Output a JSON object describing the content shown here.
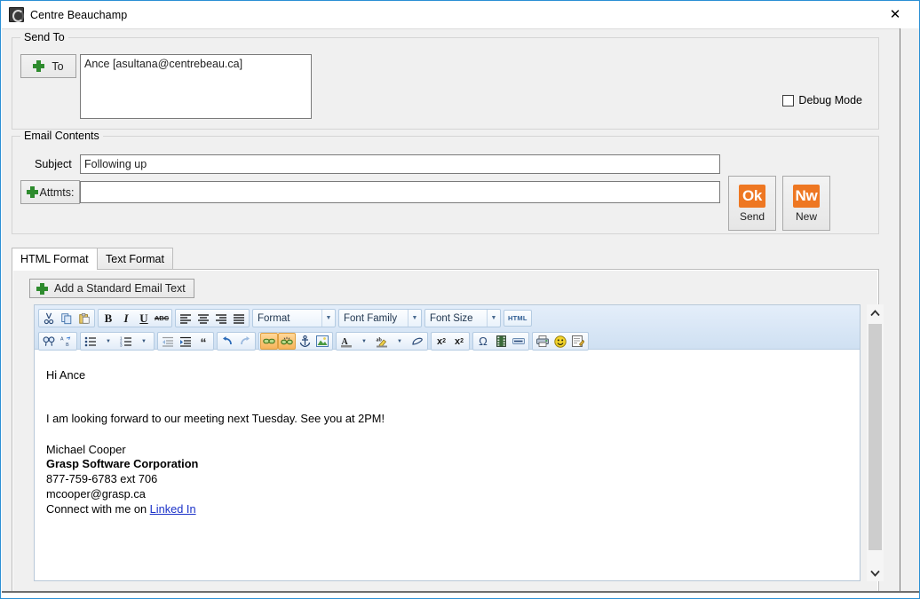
{
  "window": {
    "title": "Centre Beauchamp",
    "app_icon": "circle-c-logo-icon",
    "close_label": "✕"
  },
  "send_to": {
    "legend": "Send To",
    "to_button_label": "To",
    "to_button_icon": "plus-icon",
    "recipients_value": "Ance [asultana@centrebeau.ca]",
    "debug_mode_label": "Debug Mode",
    "debug_mode_checked": false
  },
  "email_contents": {
    "legend": "Email Contents",
    "subject_label": "Subject",
    "subject_value": "Following up",
    "attachments_button_label": "Attmts:",
    "attachments_button_icon": "plus-icon",
    "attachments_value": "",
    "actions": [
      {
        "glyph": "Ok",
        "caption": "Send",
        "name": "send-button"
      },
      {
        "glyph": "Nw",
        "caption": "New",
        "name": "new-button"
      }
    ],
    "action_glyph_color": "#ee7722"
  },
  "tabs": [
    {
      "label": "HTML Format",
      "active": true
    },
    {
      "label": "Text Format",
      "active": false
    }
  ],
  "standard_text_button": {
    "label": "Add a Standard Email Text",
    "icon": "plus-icon"
  },
  "editor": {
    "toolbar_row1": [
      {
        "group": 1,
        "name": "cut-icon",
        "glyph": "✂",
        "state": "normal"
      },
      {
        "group": 1,
        "name": "copy-icon",
        "glyph": "⧉",
        "state": "normal"
      },
      {
        "group": 1,
        "name": "paste-icon",
        "glyph": "ὌB",
        "state": "normal"
      },
      {
        "group": 2,
        "name": "bold-icon",
        "glyph": "B",
        "state": "normal"
      },
      {
        "group": 2,
        "name": "italic-icon",
        "glyph": "I",
        "state": "normal"
      },
      {
        "group": 2,
        "name": "underline-icon",
        "glyph": "U",
        "state": "normal"
      },
      {
        "group": 2,
        "name": "strikethrough-icon",
        "glyph": "ABC",
        "state": "normal"
      },
      {
        "group": 3,
        "name": "align-left-icon",
        "glyph": "≡",
        "state": "normal"
      },
      {
        "group": 3,
        "name": "align-center-icon",
        "glyph": "≡",
        "state": "normal"
      },
      {
        "group": 3,
        "name": "align-right-icon",
        "glyph": "≡",
        "state": "normal"
      },
      {
        "group": 3,
        "name": "align-justify-icon",
        "glyph": "≡",
        "state": "normal"
      }
    ],
    "selects": [
      {
        "name": "format-select",
        "label": "Format"
      },
      {
        "name": "font-family-select",
        "label": "Font Family"
      },
      {
        "name": "font-size-select",
        "label": "Font Size"
      }
    ],
    "source_button_label": "HTML",
    "toolbar_row2": [
      {
        "group": 1,
        "name": "find-icon",
        "glyph": "☍",
        "state": "normal"
      },
      {
        "group": 1,
        "name": "replace-icon",
        "glyph": "↱",
        "state": "normal"
      },
      {
        "group": 2,
        "name": "bulleted-list-icon",
        "glyph": "☰",
        "state": "normal"
      },
      {
        "group": 2,
        "name": "bulleted-list-arrow-icon",
        "glyph": "▼",
        "state": "normal"
      },
      {
        "group": 2,
        "name": "numbered-list-icon",
        "glyph": "☰",
        "state": "normal"
      },
      {
        "group": 2,
        "name": "numbered-list-arrow-icon",
        "glyph": "▼",
        "state": "normal"
      },
      {
        "group": 3,
        "name": "outdent-icon",
        "glyph": "⇤",
        "state": "disabled"
      },
      {
        "group": 3,
        "name": "indent-icon",
        "glyph": "⇥",
        "state": "normal"
      },
      {
        "group": 3,
        "name": "blockquote-icon",
        "glyph": "“",
        "state": "normal"
      },
      {
        "group": 4,
        "name": "undo-icon",
        "glyph": "↶",
        "state": "normal"
      },
      {
        "group": 4,
        "name": "redo-icon",
        "glyph": "↷",
        "state": "disabled"
      },
      {
        "group": 5,
        "name": "link-icon",
        "glyph": "⚭",
        "state": "highlighted"
      },
      {
        "group": 5,
        "name": "unlink-icon",
        "glyph": "⚭",
        "state": "highlighted"
      },
      {
        "group": 5,
        "name": "anchor-icon",
        "glyph": "⚓",
        "state": "normal"
      },
      {
        "group": 5,
        "name": "image-icon",
        "glyph": "ἳ2",
        "state": "normal"
      },
      {
        "group": 6,
        "name": "text-color-icon",
        "glyph": "A",
        "state": "normal"
      },
      {
        "group": 6,
        "name": "text-color-arrow-icon",
        "glyph": "▼",
        "state": "normal"
      },
      {
        "group": 6,
        "name": "background-color-icon",
        "glyph": "ab",
        "state": "normal"
      },
      {
        "group": 6,
        "name": "background-color-arrow-icon",
        "glyph": "▼",
        "state": "normal"
      },
      {
        "group": 6,
        "name": "remove-format-icon",
        "glyph": "◡",
        "state": "normal"
      },
      {
        "group": 7,
        "name": "subscript-icon",
        "glyph": "x",
        "state": "normal"
      },
      {
        "group": 7,
        "name": "superscript-icon",
        "glyph": "x",
        "state": "normal"
      },
      {
        "group": 8,
        "name": "special-character-icon",
        "glyph": "Ω",
        "state": "normal"
      },
      {
        "group": 8,
        "name": "flash-icon",
        "glyph": "▓",
        "state": "normal"
      },
      {
        "group": 8,
        "name": "horizontal-rule-icon",
        "glyph": "▬",
        "state": "normal"
      },
      {
        "group": 9,
        "name": "print-icon",
        "glyph": "⎙",
        "state": "normal"
      },
      {
        "group": 9,
        "name": "smiley-icon",
        "glyph": "☺",
        "state": "normal"
      },
      {
        "group": 9,
        "name": "templates-icon",
        "glyph": "✎",
        "state": "normal"
      }
    ],
    "body": {
      "greeting": "Hi Ance",
      "paragraph": "I am looking forward to our meeting next Tuesday.  See you at 2PM!",
      "signature_name": "Michael Cooper",
      "signature_company": "Grasp Software Corporation",
      "signature_phone": "877-759-6783 ext 706",
      "signature_email": "mcooper@grasp.ca",
      "signature_connect_prefix": "Connect with me on ",
      "signature_link": "Linked In"
    },
    "scrollbar": {
      "up_arrow": "▲",
      "down_arrow": "▼"
    }
  }
}
